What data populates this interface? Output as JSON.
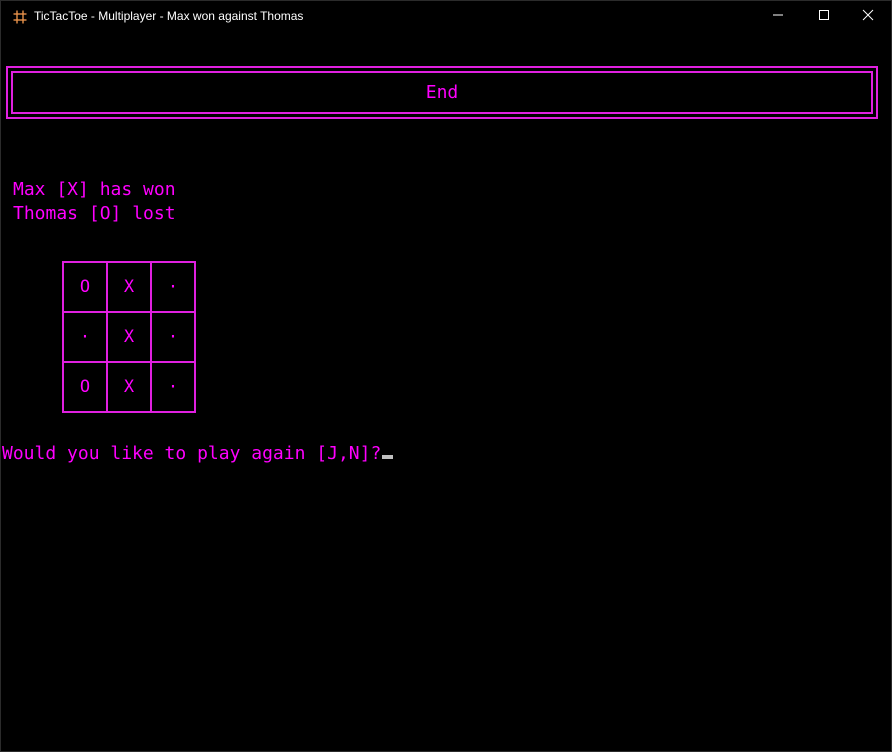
{
  "window": {
    "title": "TicTacToe - Multiplayer - Max won against Thomas",
    "icon": "hash-icon",
    "buttons": {
      "minimize": "minimize-icon",
      "maximize": "maximize-icon",
      "close": "close-icon"
    }
  },
  "console": {
    "header_title": "End",
    "winner_line": "Max [X] has won",
    "loser_line": "Thomas [O] lost",
    "board": [
      [
        "O",
        "X",
        "·"
      ],
      [
        "·",
        "X",
        "·"
      ],
      [
        "O",
        "X",
        "·"
      ]
    ],
    "prompt": "Would you like to play again [J,N]?"
  },
  "colors": {
    "text": "#ff00ff",
    "border": "#e020e0",
    "background": "#000000",
    "icon_accent": "#e8914a"
  }
}
